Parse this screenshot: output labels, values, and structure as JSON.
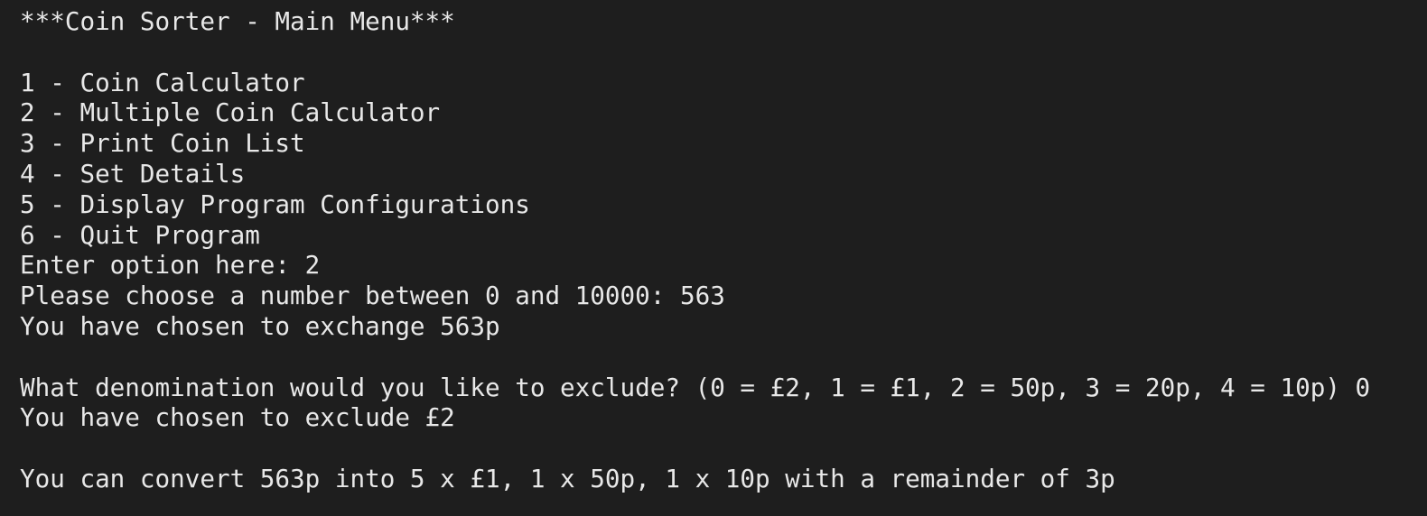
{
  "terminal": {
    "title_line": "***Coin Sorter - Main Menu***",
    "menu": [
      "1 - Coin Calculator",
      "2 - Multiple Coin Calculator",
      "3 - Print Coin List",
      "4 - Set Details",
      "5 - Display Program Configurations",
      "6 - Quit Program"
    ],
    "prompt_option": "Enter option here: 2",
    "prompt_number": "Please choose a number between 0 and 10000: 563",
    "exchange_msg": "You have chosen to exchange 563p",
    "exclude_prompt": "What denomination would you like to exclude? (0 = £2, 1 = £1, 2 = 50p, 3 = 20p, 4 = 10p) 0",
    "exclude_msg": "You have chosen to exclude £2",
    "result_msg": "You can convert 563p into 5 x £1, 1 x 50p, 1 x 10p with a remainder of 3p"
  }
}
